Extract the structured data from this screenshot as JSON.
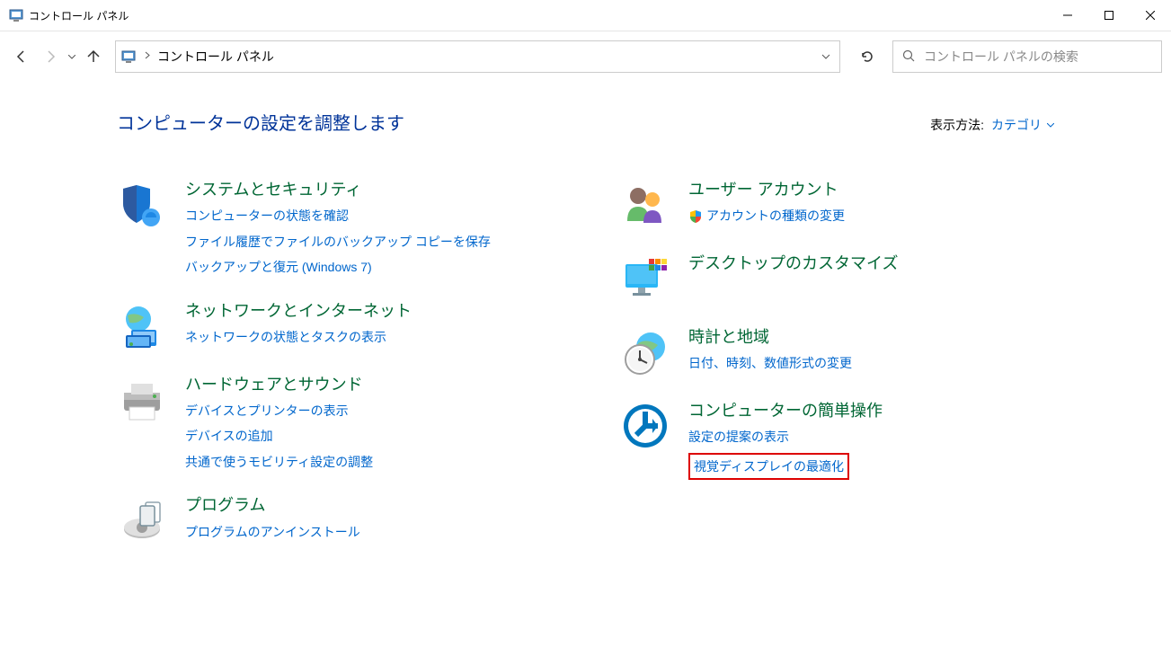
{
  "window": {
    "title": "コントロール パネル"
  },
  "breadcrumb": {
    "current": "コントロール パネル"
  },
  "search": {
    "placeholder": "コントロール パネルの検索"
  },
  "page": {
    "heading": "コンピューターの設定を調整します",
    "view_label": "表示方法:",
    "view_value": "カテゴリ"
  },
  "categories": {
    "left": [
      {
        "title": "システムとセキュリティ",
        "links": [
          "コンピューターの状態を確認",
          "ファイル履歴でファイルのバックアップ コピーを保存",
          "バックアップと復元 (Windows 7)"
        ]
      },
      {
        "title": "ネットワークとインターネット",
        "links": [
          "ネットワークの状態とタスクの表示"
        ]
      },
      {
        "title": "ハードウェアとサウンド",
        "links": [
          "デバイスとプリンターの表示",
          "デバイスの追加",
          "共通で使うモビリティ設定の調整"
        ]
      },
      {
        "title": "プログラム",
        "links": [
          "プログラムのアンインストール"
        ]
      }
    ],
    "right": [
      {
        "title": "ユーザー アカウント",
        "links": [
          "アカウントの種類の変更"
        ],
        "shield": true
      },
      {
        "title": "デスクトップのカスタマイズ",
        "links": []
      },
      {
        "title": "時計と地域",
        "links": [
          "日付、時刻、数値形式の変更"
        ]
      },
      {
        "title": "コンピューターの簡単操作",
        "links": [
          "設定の提案の表示",
          "視覚ディスプレイの最適化"
        ],
        "highlight_index": 1
      }
    ]
  }
}
